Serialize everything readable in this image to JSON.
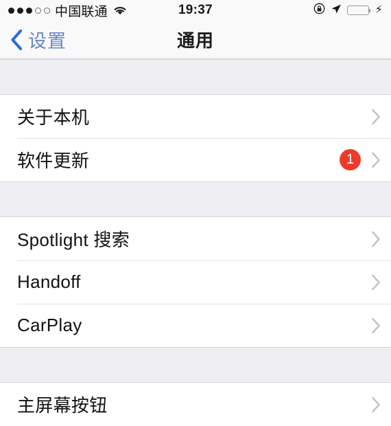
{
  "status_bar": {
    "signal_dots_filled": 3,
    "signal_dots_total": 5,
    "carrier": "中国联通",
    "wifi_icon": "wifi-icon",
    "time": "19:37",
    "rotation_lock_icon": "rotation-lock-icon",
    "location_icon": "location-arrow-icon",
    "battery_icon": "battery-icon",
    "battery_color": "#4cd964",
    "charging_icon": "lightning-bolt-icon"
  },
  "nav_bar": {
    "back_icon": "chevron-left-icon",
    "back_label": "设置",
    "back_color": "#6b86c4",
    "title": "通用"
  },
  "groups": [
    {
      "rows": [
        {
          "label": "关于本机",
          "badge": null,
          "accessory": "chevron-right-icon"
        },
        {
          "label": "软件更新",
          "badge": "1",
          "accessory": "chevron-right-icon"
        }
      ]
    },
    {
      "rows": [
        {
          "label": "Spotlight 搜索",
          "badge": null,
          "accessory": "chevron-right-icon"
        },
        {
          "label": "Handoff",
          "badge": null,
          "accessory": "chevron-right-icon"
        },
        {
          "label": "CarPlay",
          "badge": null,
          "accessory": "chevron-right-icon"
        }
      ]
    },
    {
      "rows": [
        {
          "label": "主屏幕按钮",
          "badge": null,
          "accessory": "chevron-right-icon"
        }
      ]
    }
  ],
  "colors": {
    "badge_red": "#ec3b2b",
    "group_background": "#eeeef3",
    "cell_background": "#ffffff",
    "separator": "#d6d6da"
  }
}
